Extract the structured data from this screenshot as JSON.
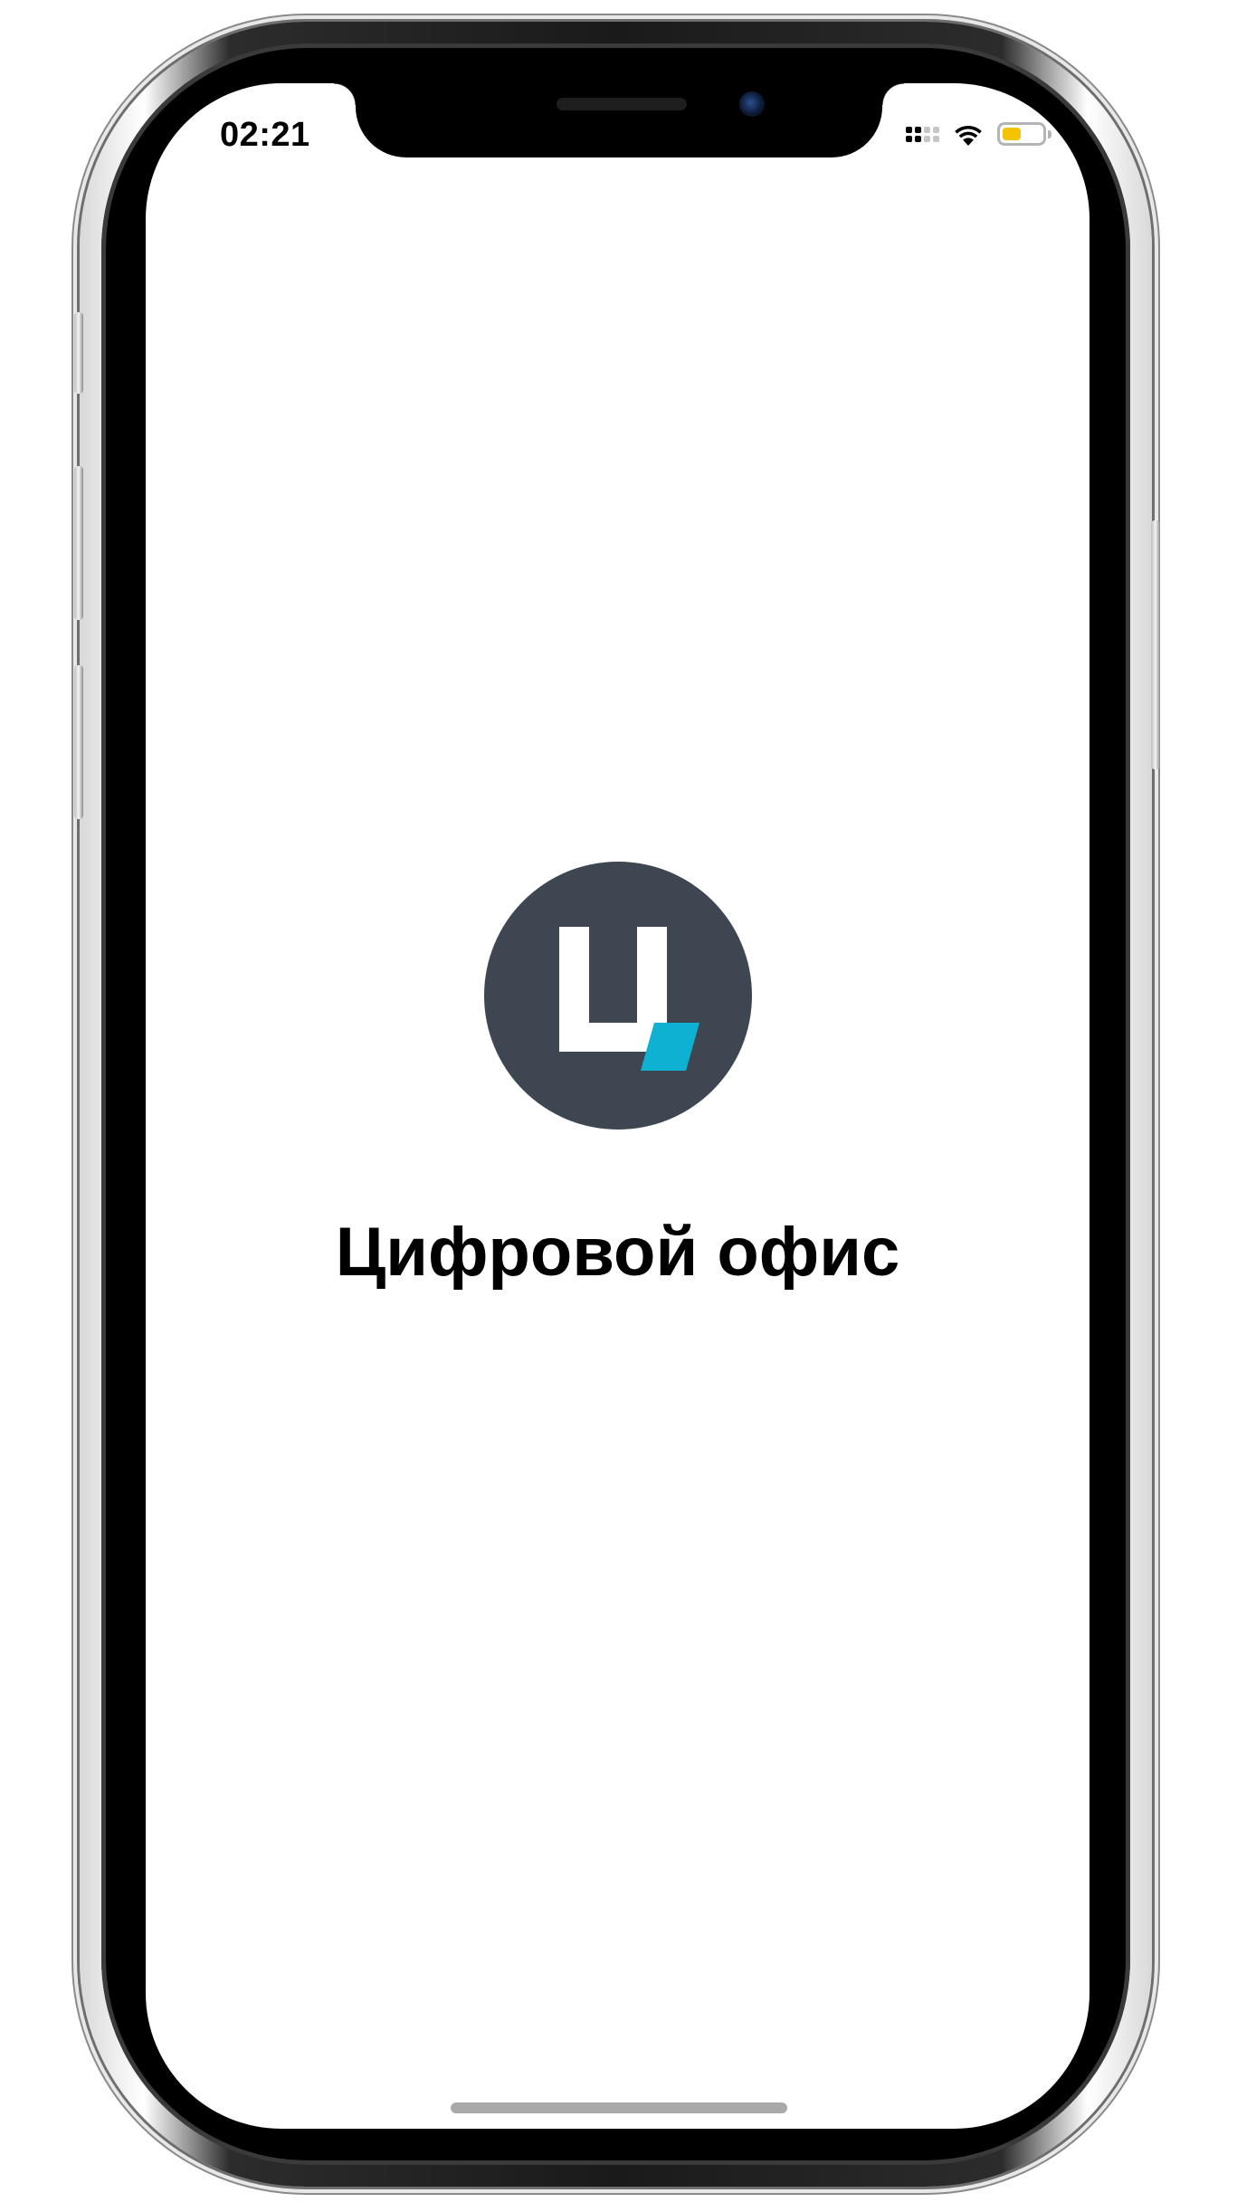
{
  "status_bar": {
    "time": "02:21",
    "signal_bars_active": 2,
    "signal_bars_total": 4,
    "wifi_icon": "wifi-icon",
    "battery_level": 0.55,
    "battery_color": "#f5c400",
    "battery_icon": "battery-icon"
  },
  "splash": {
    "logo_icon": "app-logo-icon",
    "logo_letter": "Ц",
    "logo_background": "#3d4651",
    "logo_accent": "#0fb1d3",
    "title": "Цифровой офис"
  }
}
